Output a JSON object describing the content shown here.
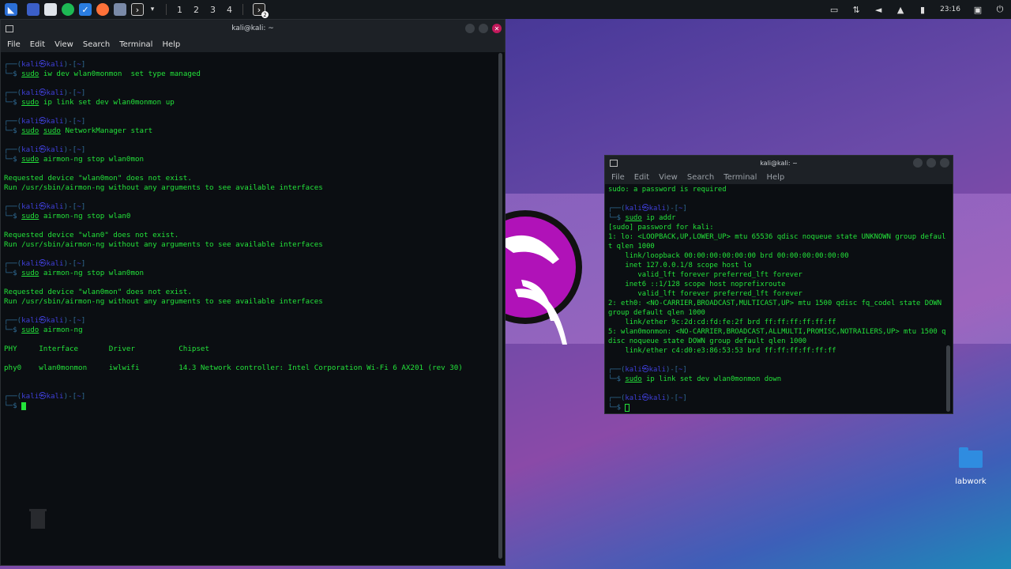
{
  "taskbar": {
    "workspaces": [
      "1",
      "2",
      "3",
      "4"
    ],
    "badge": "2",
    "clock": "23:16",
    "icons": [
      "kali-menu-icon",
      "desktop-icon",
      "files-icon",
      "spotify-icon",
      "vscode-icon",
      "firefox-icon",
      "screenshot-icon",
      "terminal-icon"
    ]
  },
  "main_terminal": {
    "title": "kali@kali: ~",
    "menu": [
      "File",
      "Edit",
      "View",
      "Search",
      "Terminal",
      "Help"
    ],
    "prompt_user": "kali",
    "prompt_host": "kali",
    "blocks": [
      {
        "type": "prompt",
        "cmd": "iw dev wlan0monmon  set type managed"
      },
      {
        "type": "blank"
      },
      {
        "type": "prompt",
        "cmd": "ip link set dev wlan0monmon up"
      },
      {
        "type": "blank"
      },
      {
        "type": "prompt",
        "cmd": "sudo NetworkManager start",
        "double_sudo": true
      },
      {
        "type": "blank"
      },
      {
        "type": "prompt",
        "cmd": "airmon-ng stop wlan0mon"
      },
      {
        "type": "blank"
      },
      {
        "type": "out",
        "text": "Requested device \"wlan0mon\" does not exist."
      },
      {
        "type": "out",
        "text": "Run /usr/sbin/airmon-ng without any arguments to see available interfaces"
      },
      {
        "type": "blank"
      },
      {
        "type": "prompt",
        "cmd": "airmon-ng stop wlan0"
      },
      {
        "type": "blank"
      },
      {
        "type": "out",
        "text": "Requested device \"wlan0\" does not exist."
      },
      {
        "type": "out",
        "text": "Run /usr/sbin/airmon-ng without any arguments to see available interfaces"
      },
      {
        "type": "blank"
      },
      {
        "type": "prompt",
        "cmd": "airmon-ng stop wlan0mon"
      },
      {
        "type": "blank"
      },
      {
        "type": "out",
        "text": "Requested device \"wlan0mon\" does not exist."
      },
      {
        "type": "out",
        "text": "Run /usr/sbin/airmon-ng without any arguments to see available interfaces"
      },
      {
        "type": "blank"
      },
      {
        "type": "prompt",
        "cmd": "airmon-ng"
      },
      {
        "type": "blank"
      },
      {
        "type": "out",
        "text": "PHY     Interface       Driver          Chipset"
      },
      {
        "type": "blank"
      },
      {
        "type": "out",
        "text": "phy0    wlan0monmon     iwlwifi         14.3 Network controller: Intel Corporation Wi-Fi 6 AX201 (rev 30)"
      },
      {
        "type": "blank"
      },
      {
        "type": "blank"
      },
      {
        "type": "prompt_cursor"
      }
    ]
  },
  "second_terminal": {
    "title": "kali@kali: ~",
    "menu": [
      "File",
      "Edit",
      "View",
      "Search",
      "Terminal",
      "Help"
    ],
    "blocks": [
      {
        "type": "out",
        "text": "sudo: a password is required"
      },
      {
        "type": "blank"
      },
      {
        "type": "prompt",
        "cmd": "ip addr"
      },
      {
        "type": "out",
        "text": "[sudo] password for kali:"
      },
      {
        "type": "out",
        "text": "1: lo: <LOOPBACK,UP,LOWER_UP> mtu 65536 qdisc noqueue state UNKNOWN group defaul"
      },
      {
        "type": "out",
        "text": "t qlen 1000"
      },
      {
        "type": "out",
        "text": "    link/loopback 00:00:00:00:00:00 brd 00:00:00:00:00:00"
      },
      {
        "type": "out",
        "text": "    inet 127.0.0.1/8 scope host lo"
      },
      {
        "type": "out",
        "text": "       valid_lft forever preferred_lft forever"
      },
      {
        "type": "out",
        "text": "    inet6 ::1/128 scope host noprefixroute"
      },
      {
        "type": "out",
        "text": "       valid_lft forever preferred_lft forever"
      },
      {
        "type": "out",
        "text": "2: eth0: <NO-CARRIER,BROADCAST,MULTICAST,UP> mtu 1500 qdisc fq_codel state DOWN"
      },
      {
        "type": "out",
        "text": "group default qlen 1000"
      },
      {
        "type": "out",
        "text": "    link/ether 9c:2d:cd:fd:fe:2f brd ff:ff:ff:ff:ff:ff"
      },
      {
        "type": "out",
        "text": "5: wlan0monmon: <NO-CARRIER,BROADCAST,ALLMULTI,PROMISC,NOTRAILERS,UP> mtu 1500 q"
      },
      {
        "type": "out",
        "text": "disc noqueue state DOWN group default qlen 1000"
      },
      {
        "type": "out",
        "text": "    link/ether c4:d0:e3:86:53:53 brd ff:ff:ff:ff:ff:ff"
      },
      {
        "type": "blank"
      },
      {
        "type": "prompt",
        "cmd": "ip link set dev wlan0monmon down"
      },
      {
        "type": "blank"
      },
      {
        "type": "prompt_cursor",
        "hollow": true
      }
    ]
  },
  "desktop": {
    "folder_label": "labwork"
  },
  "colors": {
    "terminal_green": "#23e23a",
    "prompt_blue": "#2f6b94",
    "user_blue": "#3f3fd8",
    "close_red": "#c2185b",
    "kali_magenta": "#b012b8"
  }
}
